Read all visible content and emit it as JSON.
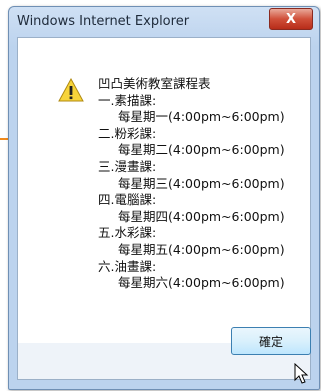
{
  "dialog": {
    "title": "Windows Internet Explorer",
    "close_glyph": "X",
    "icon": "warning-icon",
    "message_lines": [
      "凹凸美術教室課程表",
      "一.素描課:",
      "每星期一(4:00pm~6:00pm)",
      "二.粉彩課:",
      "每星期二(4:00pm~6:00pm)",
      "三.漫畫課:",
      "每星期三(4:00pm~6:00pm)",
      "四.電腦課:",
      "每星期四(4:00pm~6:00pm)",
      "五.水彩課:",
      "每星期五(4:00pm~6:00pm)",
      "六.油畫課:",
      "每星期六(4:00pm~6:00pm)"
    ],
    "ok_label": "確定"
  },
  "colors": {
    "arrow": "#f08a1c",
    "warning_fill": "#f7d43a",
    "close_button": "#c9442e"
  }
}
